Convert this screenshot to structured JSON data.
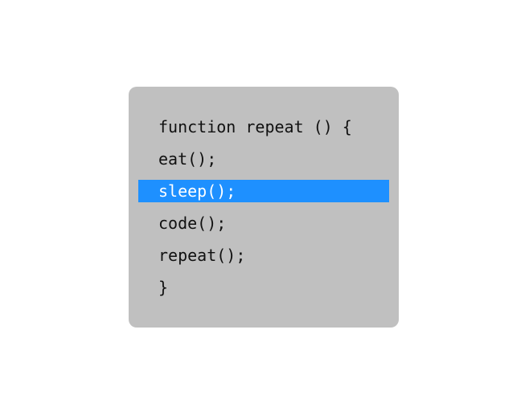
{
  "code_block": {
    "highlight_color": "#1e90ff",
    "background_color": "#c0c0c0",
    "highlighted_line_index": 2,
    "lines": [
      "function repeat () {",
      "eat();",
      "sleep();",
      "code();",
      "repeat();",
      "}"
    ]
  }
}
